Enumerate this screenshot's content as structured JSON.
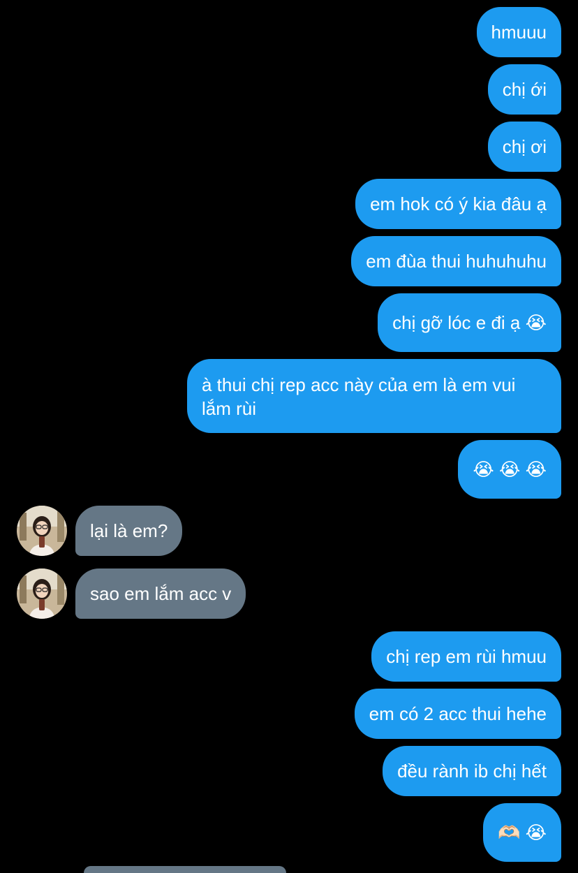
{
  "conversation": {
    "messages": [
      {
        "sender": "me",
        "text": "hmuuu"
      },
      {
        "sender": "me",
        "text": "chị ới"
      },
      {
        "sender": "me",
        "text": "chị ơi"
      },
      {
        "sender": "me",
        "text": "em hok có ý kia đâu ạ"
      },
      {
        "sender": "me",
        "text": "em đùa thui huhuhuhu"
      },
      {
        "sender": "me",
        "text": "chị gỡ lóc e đi ạ 😭"
      },
      {
        "sender": "me",
        "text": "à thui chị rep acc này của em là em vui lắm rùi"
      },
      {
        "sender": "me",
        "text": "😭 😭 😭"
      },
      {
        "sender": "them",
        "text": "lại là em?"
      },
      {
        "sender": "them",
        "text": "sao em lắm acc v"
      },
      {
        "sender": "me",
        "text": "chị rep em rùi hmuu"
      },
      {
        "sender": "me",
        "text": "em có 2 acc thui hehe"
      },
      {
        "sender": "me",
        "text": "đều rành ib chị hết"
      },
      {
        "sender": "me",
        "text": "🫶🏻 😭"
      }
    ]
  },
  "colors": {
    "background": "#000000",
    "sent_bubble": "#1d9bf0",
    "received_bubble": "#657786",
    "text": "#ffffff"
  },
  "icons": {
    "avatar": "contact-avatar"
  }
}
